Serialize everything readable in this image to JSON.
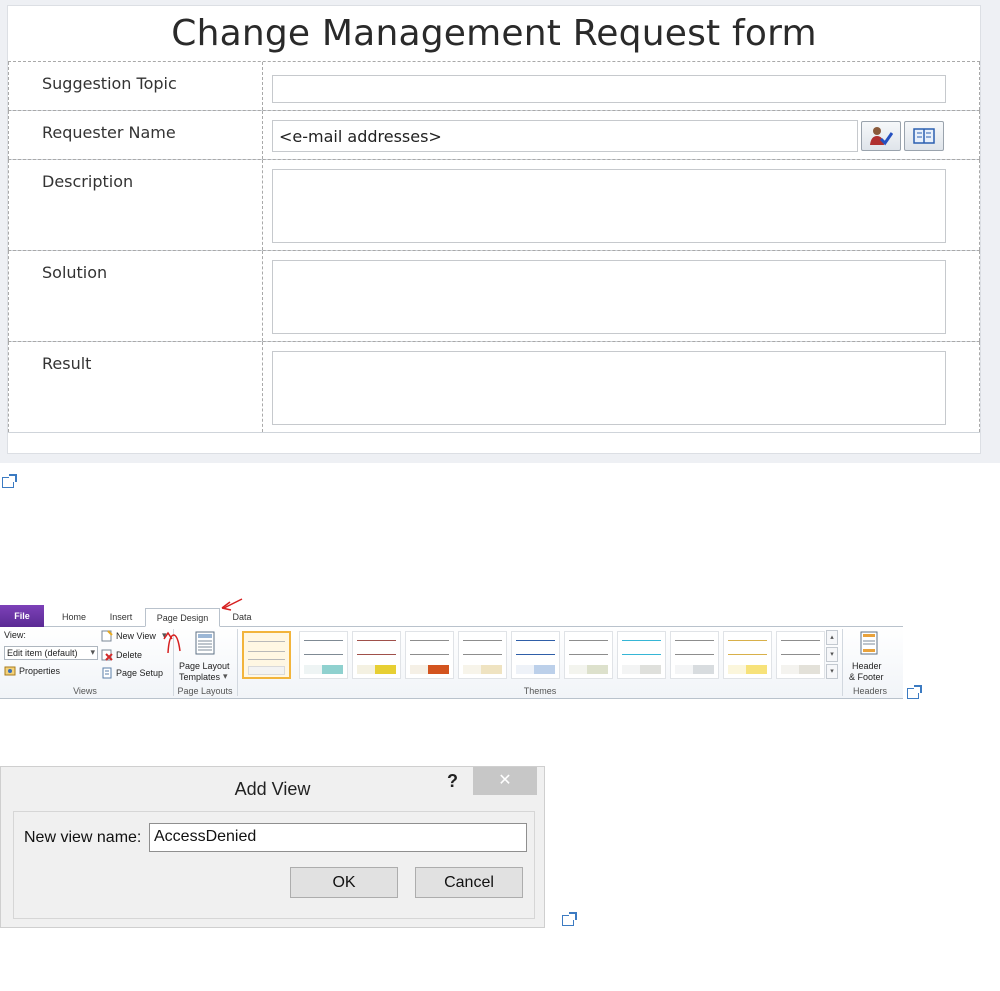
{
  "form": {
    "title": "Change Management Request form",
    "fields": [
      {
        "label": "Suggestion Topic",
        "value": ""
      },
      {
        "label": "Requester Name",
        "value": "<e-mail addresses>"
      },
      {
        "label": "Description",
        "value": ""
      },
      {
        "label": "Solution",
        "value": ""
      },
      {
        "label": "Result",
        "value": ""
      }
    ],
    "icons": {
      "check_names": "person-check-icon",
      "address_book": "address-book-icon",
      "external": "open-in-new-icon"
    }
  },
  "ribbon": {
    "tabs": [
      "File",
      "Home",
      "Insert",
      "Page Design",
      "Data"
    ],
    "active_tab": "Page Design",
    "views_group": {
      "view_label": "View:",
      "view_select": "Edit item (default)",
      "new_view": "New View",
      "delete": "Delete",
      "properties": "Properties",
      "page_setup": "Page Setup",
      "group_label": "Views"
    },
    "page_layouts_group": {
      "button_line1": "Page Layout",
      "button_line2": "Templates",
      "group_label": "Page Layouts"
    },
    "themes_group": {
      "group_label": "Themes",
      "accent_colors": [
        "#8fd1cf",
        "#e7cf33",
        "#d3541f",
        "#efe3c1",
        "#bcd0ea",
        "#dde1cc",
        "#dfe0dc",
        "#d8dcdf",
        "#f7e27a",
        "#e3e1d9"
      ]
    },
    "headers_group": {
      "button_line1": "Header",
      "button_line2": "& Footer",
      "group_label": "Headers"
    },
    "annotation_color": "#d62020"
  },
  "dialog": {
    "title": "Add View",
    "help": "?",
    "close": "✕",
    "label": "New view name:",
    "value": "AccessDenied",
    "ok": "OK",
    "cancel": "Cancel"
  }
}
